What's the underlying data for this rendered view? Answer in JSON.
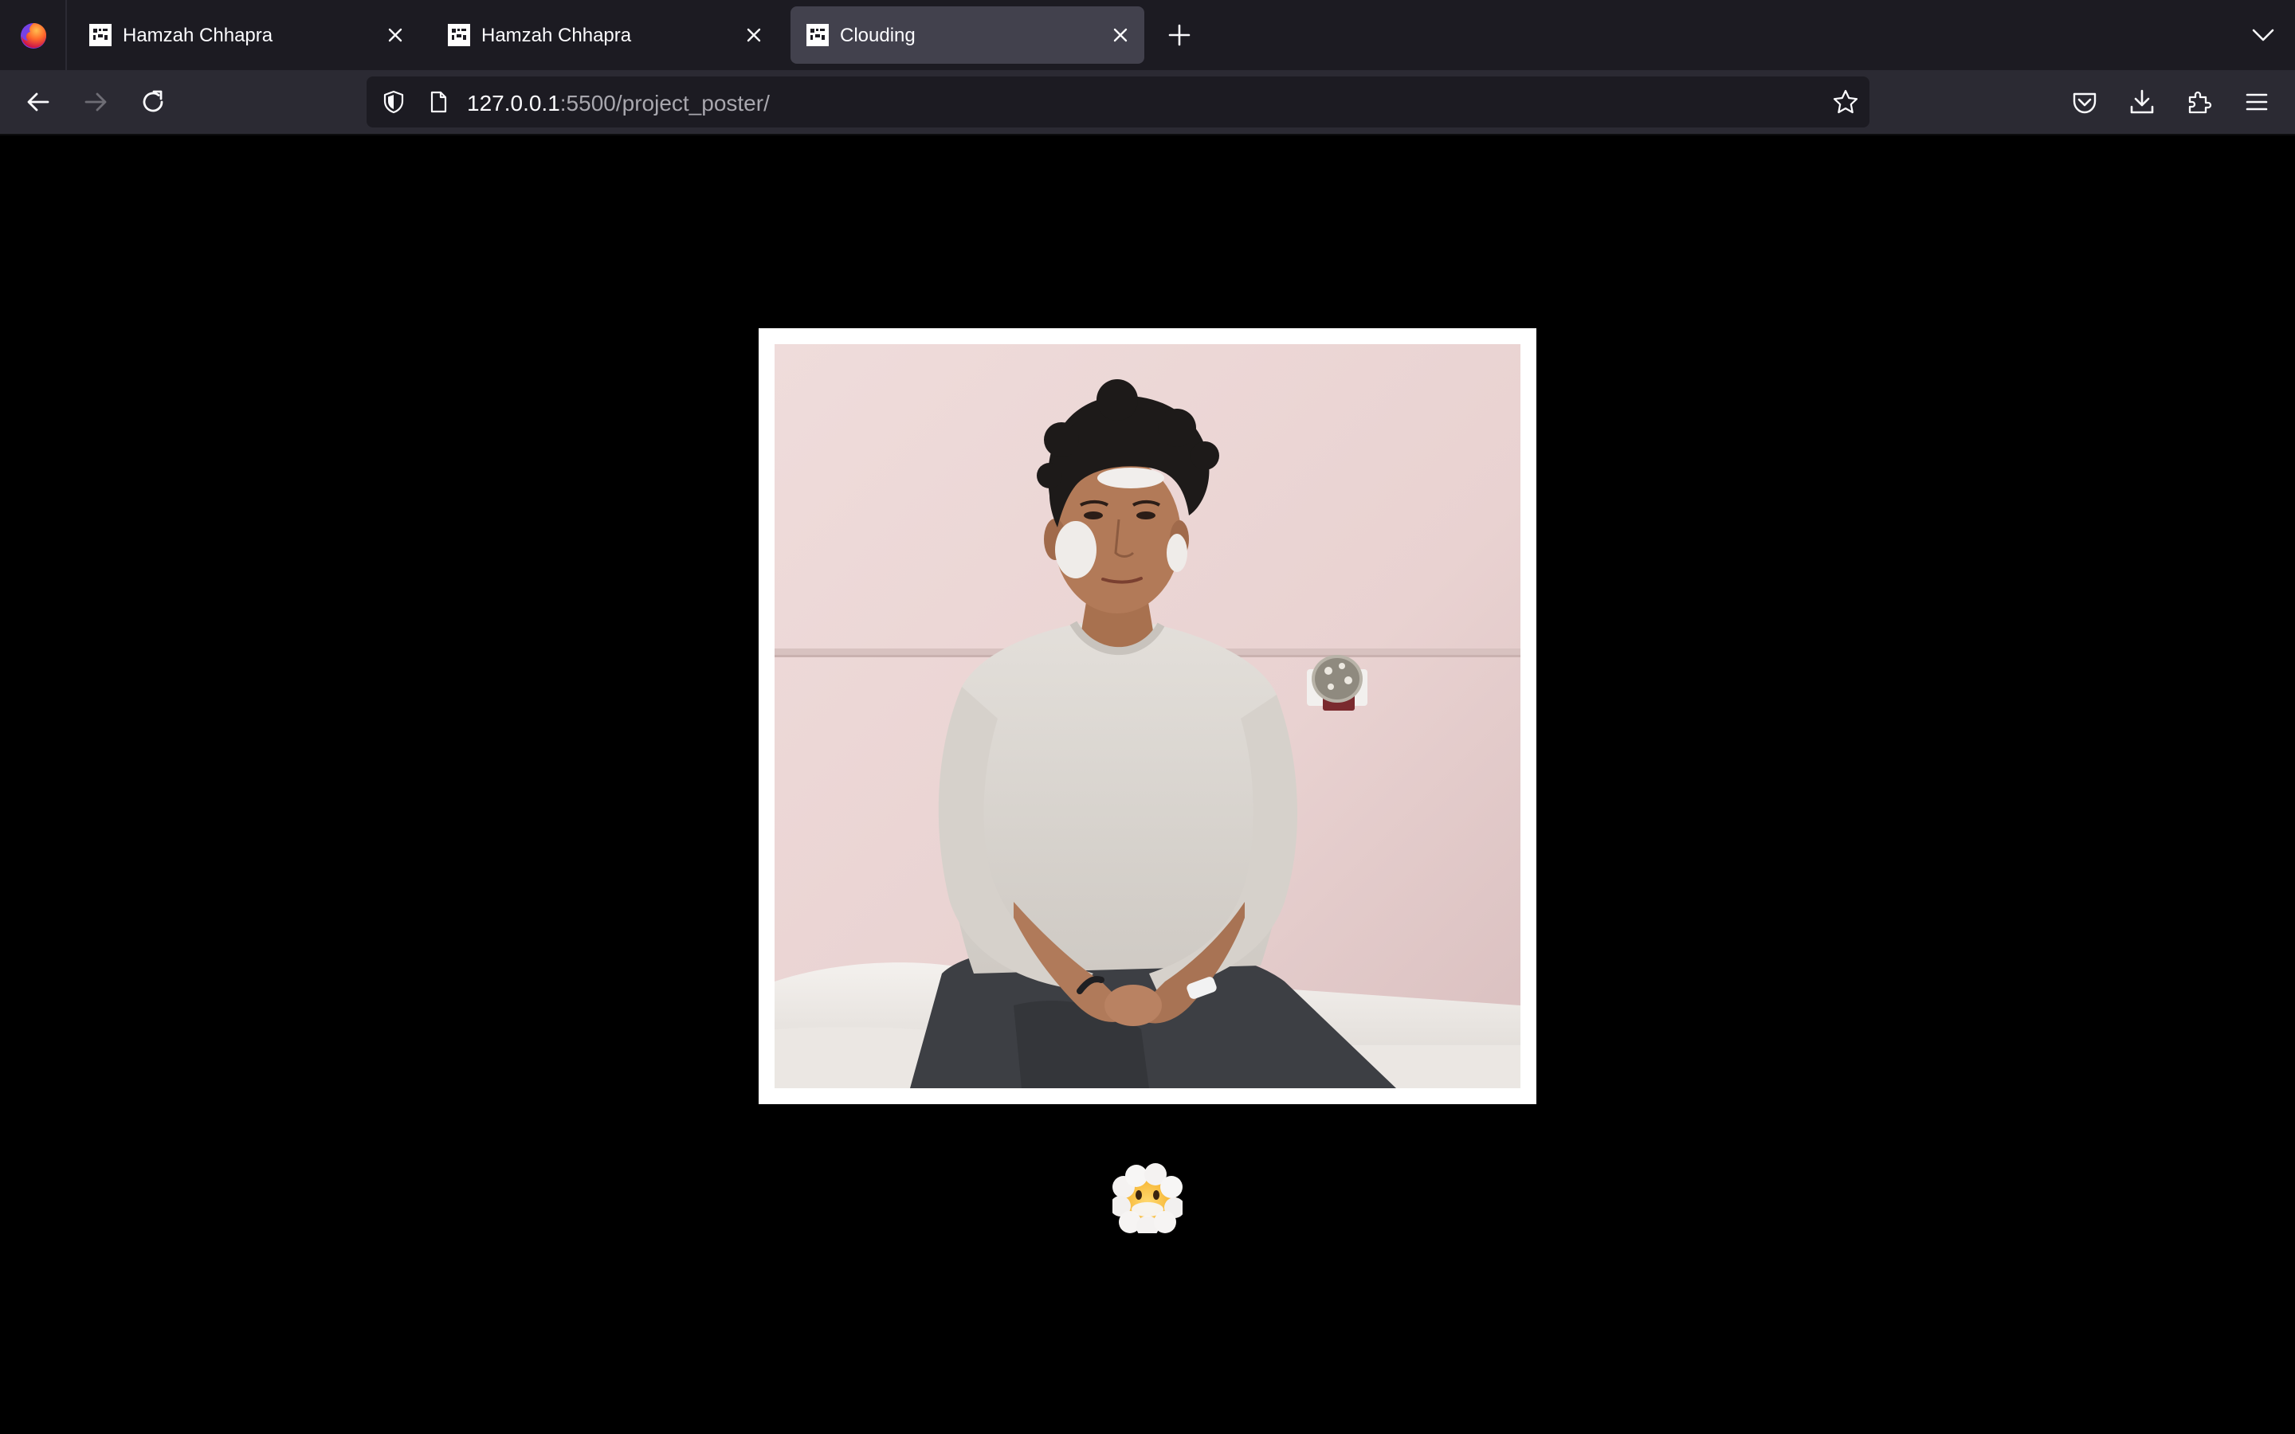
{
  "browser": {
    "tabs": [
      {
        "title": "Hamzah Chhapra",
        "active": false
      },
      {
        "title": "Hamzah Chhapra",
        "active": false
      },
      {
        "title": "Clouding",
        "active": true
      }
    ],
    "url": {
      "host": "127.0.0.1",
      "rest": ":5500/project_poster/"
    },
    "icons": {
      "logo": "firefox-logo-icon",
      "new_tab": "plus-icon",
      "tab_list": "chevron-down-icon",
      "back": "back-arrow-icon",
      "forward": "forward-arrow-icon",
      "reload": "reload-icon",
      "tracking": "shield-icon",
      "page_info": "page-icon",
      "bookmark": "star-icon",
      "pocket": "pocket-icon",
      "downloads": "download-icon",
      "extensions": "puzzle-icon",
      "menu": "hamburger-menu-icon"
    },
    "colors": {
      "tabstrip": "#1c1b22",
      "navbar": "#2b2a33",
      "active_tab": "#42414d",
      "page_background": "#000000",
      "frame": "#ffffff"
    }
  },
  "page": {
    "poster": {
      "image": "portrait photo of a young man in a light grey sweatshirt sitting on a white bed against a pink wall",
      "frame_color": "#ffffff"
    },
    "cloud_button": {
      "icon": "face-in-clouds-emoji-icon"
    }
  }
}
